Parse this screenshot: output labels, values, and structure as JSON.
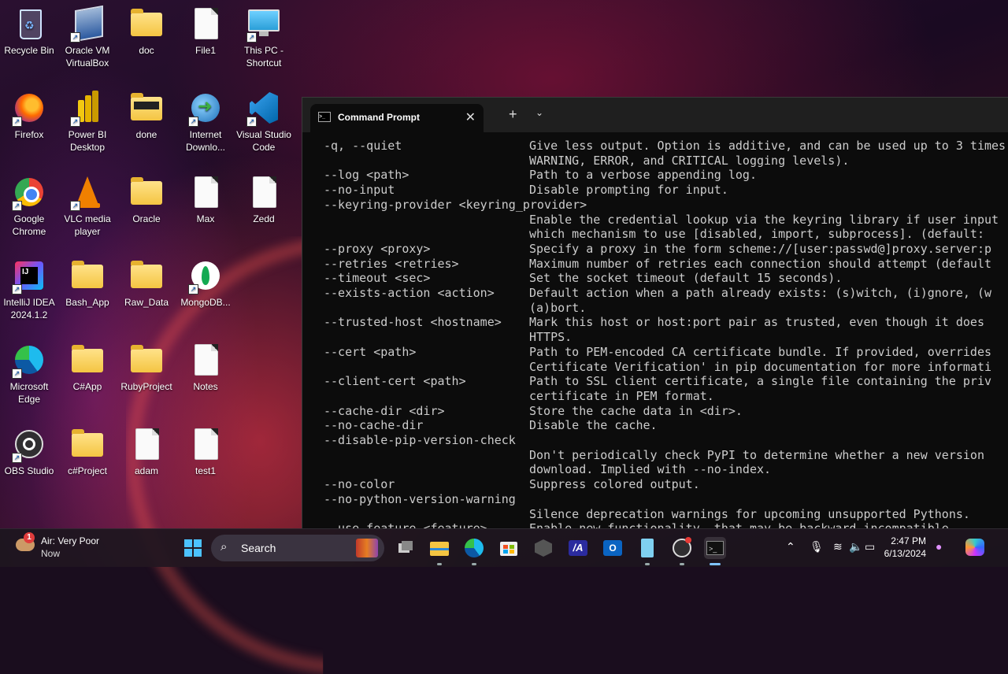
{
  "desktop": {
    "icons": [
      {
        "label": "Recycle Bin"
      },
      {
        "label": "Oracle VM VirtualBox"
      },
      {
        "label": "doc"
      },
      {
        "label": "File1"
      },
      {
        "label": "This PC - Shortcut"
      },
      {
        "label": "Firefox"
      },
      {
        "label": "Power BI Desktop"
      },
      {
        "label": "done"
      },
      {
        "label": "Internet Downlo..."
      },
      {
        "label": "Visual Studio Code"
      },
      {
        "label": "Google Chrome"
      },
      {
        "label": "VLC media player"
      },
      {
        "label": "Oracle"
      },
      {
        "label": "Max"
      },
      {
        "label": "Zedd"
      },
      {
        "label": "IntelliJ IDEA 2024.1.2"
      },
      {
        "label": "Bash_App"
      },
      {
        "label": "Raw_Data"
      },
      {
        "label": "MongoDB..."
      },
      {
        "label": "Microsoft Edge"
      },
      {
        "label": "C#App"
      },
      {
        "label": "RubyProject"
      },
      {
        "label": "Notes"
      },
      {
        "label": "OBS Studio"
      },
      {
        "label": "c#Project"
      },
      {
        "label": "adam"
      },
      {
        "label": "test1"
      }
    ]
  },
  "terminal": {
    "tab_title": "Command Prompt",
    "close_glyph": "✕",
    "new_tab_glyph": "+",
    "menu_glyph": "⌄",
    "lines": [
      {
        "opt": "-q, --quiet",
        "desc": "Give less output. Option is additive, and can be used up to 3 times"
      },
      {
        "opt": "",
        "desc": "WARNING, ERROR, and CRITICAL logging levels)."
      },
      {
        "opt": "--log <path>",
        "desc": "Path to a verbose appending log."
      },
      {
        "opt": "--no-input",
        "desc": "Disable prompting for input."
      },
      {
        "opt": "--keyring-provider <keyring_provider>",
        "desc": ""
      },
      {
        "opt": "",
        "desc": "Enable the credential lookup via the keyring library if user input"
      },
      {
        "opt": "",
        "desc": "which mechanism to use [disabled, import, subprocess]. (default: "
      },
      {
        "opt": "--proxy <proxy>",
        "desc": "Specify a proxy in the form scheme://[user:passwd@]proxy.server:p"
      },
      {
        "opt": "--retries <retries>",
        "desc": "Maximum number of retries each connection should attempt (default"
      },
      {
        "opt": "--timeout <sec>",
        "desc": "Set the socket timeout (default 15 seconds)."
      },
      {
        "opt": "--exists-action <action>",
        "desc": "Default action when a path already exists: (s)witch, (i)gnore, (w"
      },
      {
        "opt": "",
        "desc": "(a)bort."
      },
      {
        "opt": "--trusted-host <hostname>",
        "desc": "Mark this host or host:port pair as trusted, even though it does"
      },
      {
        "opt": "",
        "desc": "HTTPS."
      },
      {
        "opt": "--cert <path>",
        "desc": "Path to PEM-encoded CA certificate bundle. If provided, overrides"
      },
      {
        "opt": "",
        "desc": "Certificate Verification' in pip documentation for more informati"
      },
      {
        "opt": "--client-cert <path>",
        "desc": "Path to SSL client certificate, a single file containing the priv"
      },
      {
        "opt": "",
        "desc": "certificate in PEM format."
      },
      {
        "opt": "--cache-dir <dir>",
        "desc": "Store the cache data in <dir>."
      },
      {
        "opt": "--no-cache-dir",
        "desc": "Disable the cache."
      },
      {
        "opt": "--disable-pip-version-check",
        "desc": ""
      },
      {
        "opt": "",
        "desc": "Don't periodically check PyPI to determine whether a new version"
      },
      {
        "opt": "",
        "desc": "download. Implied with --no-index."
      },
      {
        "opt": "--no-color",
        "desc": "Suppress colored output."
      },
      {
        "opt": "--no-python-version-warning",
        "desc": ""
      },
      {
        "opt": "",
        "desc": "Silence deprecation warnings for upcoming unsupported Pythons."
      },
      {
        "opt": "--use-feature <feature>",
        "desc": "Enable new functionality, that may be backward incompatible."
      }
    ]
  },
  "taskbar": {
    "weather_title": "Air: Very Poor",
    "weather_sub": "Now",
    "weather_badge": "1",
    "search_label": "Search",
    "time": "2:47 PM",
    "date": "6/13/2024"
  },
  "colors": {
    "terminal_bg": "#0c0c0c",
    "terminal_text": "#cccccc",
    "folder": "#f4c542",
    "accent": "#0078d4"
  }
}
